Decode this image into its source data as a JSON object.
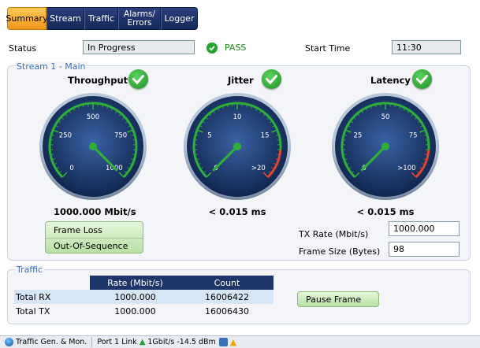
{
  "tabs": [
    {
      "label": "Summary",
      "active": true
    },
    {
      "label": "Stream",
      "active": false
    },
    {
      "label": "Traffic",
      "active": false
    },
    {
      "label_line1": "Alarms/",
      "label_line2": "Errors",
      "active": false
    },
    {
      "label": "Logger",
      "active": false
    }
  ],
  "status": {
    "label": "Status",
    "value": "In Progress",
    "result": "PASS",
    "start_time_label": "Start Time",
    "start_time_value": "11:30"
  },
  "stream_panel": {
    "title": "Stream 1 - Main",
    "gauges": [
      {
        "title": "Throughput",
        "ticks": [
          "0",
          "250",
          "500",
          "750",
          "1000"
        ],
        "reading": "1000.000 Mbit/s",
        "needle_fraction": 1.0,
        "red_zone": false,
        "status": "pass"
      },
      {
        "title": "Jitter",
        "ticks": [
          "0",
          "5",
          "10",
          "15",
          ">20"
        ],
        "reading": "< 0.015 ms",
        "needle_fraction": 0.0,
        "red_zone": true,
        "status": "pass"
      },
      {
        "title": "Latency",
        "ticks": [
          "0",
          "25",
          "50",
          "75",
          ">100"
        ],
        "reading": "< 0.015 ms",
        "needle_fraction": 0.0,
        "red_zone": true,
        "status": "pass"
      }
    ],
    "indicators": [
      "Frame Loss",
      "Out-Of-Sequence"
    ],
    "tx_rate_label": "TX Rate (Mbit/s)",
    "tx_rate_value": "1000.000",
    "frame_size_label": "Frame Size (Bytes)",
    "frame_size_value": "98"
  },
  "traffic_panel": {
    "title": "Traffic",
    "columns": [
      "Rate (Mbit/s)",
      "Count"
    ],
    "rows": [
      {
        "label": "Total RX",
        "rate": "1000.000",
        "count": "16006422"
      },
      {
        "label": "Total TX",
        "rate": "1000.000",
        "count": "16006430"
      }
    ],
    "pause_frame_label": "Pause Frame"
  },
  "statusbar": {
    "app": "Traffic Gen. & Mon.",
    "port": "Port 1 Link",
    "speed": "1Gbit/s -14.5 dBm"
  },
  "colors": {
    "pass_green": "#22a52c",
    "tab_active": "#f0961a",
    "tab_inactive": "#142858",
    "gauge_face": "#1c3a6e",
    "gauge_scale": "#2fae3a",
    "gauge_red": "#e0452d",
    "table_header": "#1d3569"
  }
}
